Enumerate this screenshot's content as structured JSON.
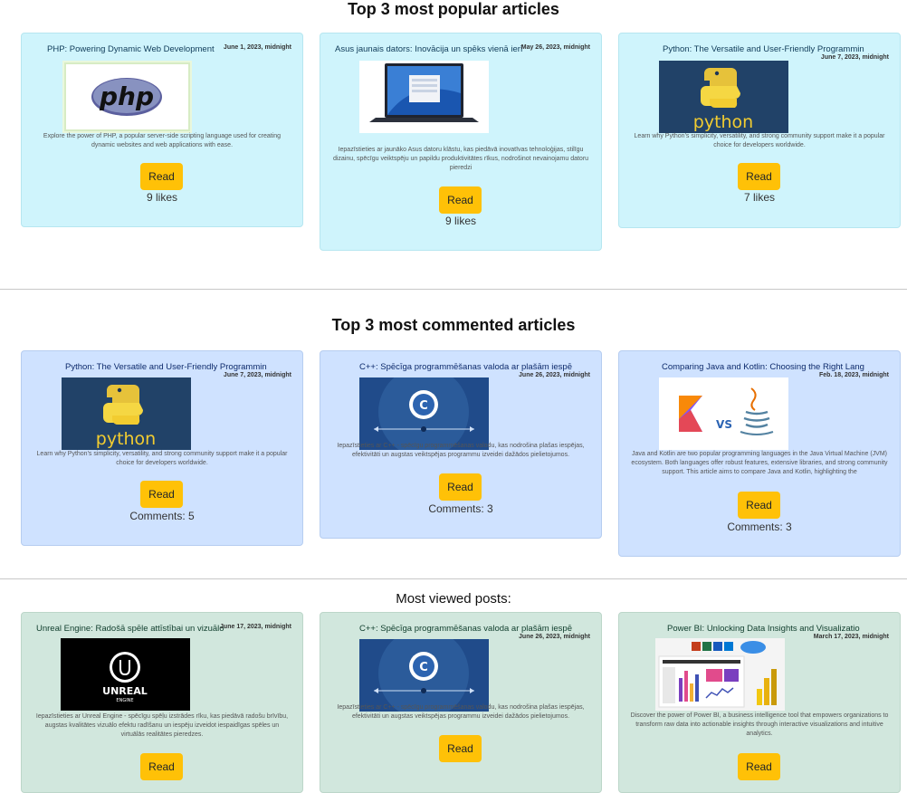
{
  "sections": {
    "popular": {
      "title": "Top 3 most popular articles",
      "cards": [
        {
          "title": "PHP: Powering Dynamic Web Development",
          "date": "June 1, 2023, midnight",
          "image": "php-logo",
          "desc": "Explore the power of PHP, a popular server-side scripting language used for creating dynamic websites and web applications with ease.",
          "read": "Read",
          "stat": "9 likes"
        },
        {
          "title": "Asus jaunais dators: Inovācija un spēks vienā ierī",
          "date": "May 26, 2023, midnight",
          "image": "asus-laptop",
          "desc": "Iepazīstieties ar jaunāko Asus datoru klāstu, kas piedāvā inovatīvas tehnoloģijas, stilīgu dizainu, spēcīgu veiktspēju un papildu produktivitātes rīkus, nodrošinot nevainojamu datoru pieredzi",
          "read": "Read",
          "stat": "9 likes"
        },
        {
          "title": "Python: The Versatile and User-Friendly Programmin",
          "date": "June 7, 2023, midnight",
          "image": "python-logo",
          "desc": "Learn why Python's simplicity, versatility, and strong community support make it a popular choice for developers worldwide.",
          "read": "Read",
          "stat": "7 likes"
        }
      ]
    },
    "commented": {
      "title": "Top 3 most commented articles",
      "cards": [
        {
          "title": "Python: The Versatile and User-Friendly Programmin",
          "date": "June 7, 2023, midnight",
          "image": "python-logo",
          "desc": "Learn why Python's simplicity, versatility, and strong community support make it a popular choice for developers worldwide.",
          "read": "Read",
          "stat": "Comments: 5"
        },
        {
          "title": "C++: Spēcīga programmēšanas valoda ar plašām iespē",
          "date": "June 26, 2023, midnight",
          "image": "cpp-logo",
          "desc": "Iepazīstieties ar C++ - spēcīgu programmēšanas valodu, kas nodrošina plašas iespējas, efektivitāti un augstas veiktspējas programmu izveidei dažādos pielietojumos.",
          "read": "Read",
          "stat": "Comments: 3"
        },
        {
          "title": "Comparing Java and Kotlin: Choosing the Right Lang",
          "date": "Feb. 18, 2023, midnight",
          "image": "kotlin-vs-java",
          "desc": "Java and Kotlin are two popular programming languages in the Java Virtual Machine (JVM) ecosystem. Both languages offer robust features, extensive libraries, and strong community support. This article aims to compare Java and Kotlin, highlighting the",
          "read": "Read",
          "stat": "Comments: 3"
        }
      ]
    },
    "viewed": {
      "title": "Most viewed posts:",
      "cards": [
        {
          "title": "Unreal Engine: Radošā spēle attīstībai un vizuālo",
          "date": "June 17, 2023, midnight",
          "image": "unreal-logo",
          "desc": "Iepazīstieties ar Unreal Engine - spēcīgu spēļu izstrādes rīku, kas piedāvā radošu brīvību, augstas kvalitātes vizuālo efektu radīšanu un iespēju izveidot iespaidīgas spēles un virtuālās realitātes pieredzes.",
          "read": "Read"
        },
        {
          "title": "C++: Spēcīga programmēšanas valoda ar plašām iespē",
          "date": "June 26, 2023, midnight",
          "image": "cpp-logo",
          "desc": "Iepazīstieties ar C++ - spēcīgu programmēšanas valodu, kas nodrošina plašas iespējas, efektivitāti un augstas veiktspējas programmu izveidei dažādos pielietojumos.",
          "read": "Read"
        },
        {
          "title": "Power BI: Unlocking Data Insights and Visualizatio",
          "date": "March 17, 2023, midnight",
          "image": "powerbi-dashboard",
          "desc": "Discover the power of Power BI, a business intelligence tool that empowers organizations to transform raw data into actionable insights through interactive visualizations and intuitive analytics.",
          "read": "Read"
        }
      ]
    }
  },
  "images": {
    "php": "php",
    "python": "python",
    "unreal_top": "UNREAL",
    "unreal_bottom": "ENGINE",
    "vs": "VS"
  },
  "colors": {
    "cyan_card": "#cff4fc",
    "blue_card": "#cfe2ff",
    "green_card": "#d1e7dd",
    "read_button": "#ffc107"
  }
}
